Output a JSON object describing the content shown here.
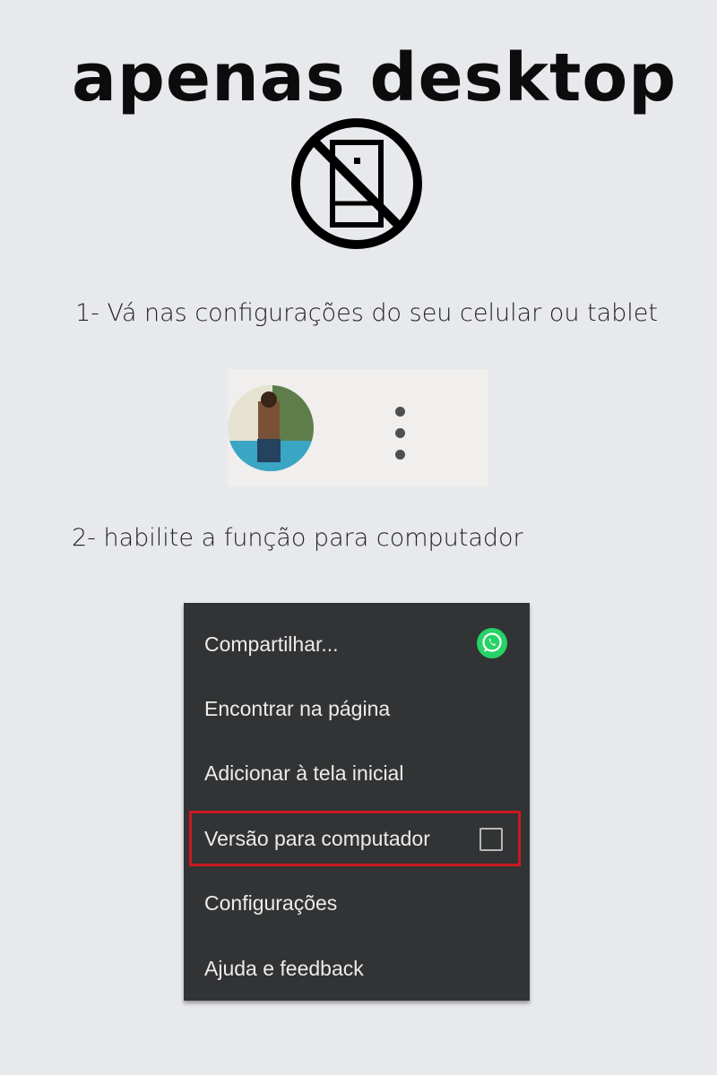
{
  "headline": "apenas desktop",
  "icons": {
    "no_mobile": "no-mobile-phone-icon",
    "whatsapp": "whatsapp-icon",
    "more_options": "more-vert-icon"
  },
  "steps": {
    "step1": "1- Vá nas configurações do seu celular ou tablet",
    "step2": "2- habilite a função para computador"
  },
  "menu": {
    "items": [
      {
        "label": "Compartilhar..."
      },
      {
        "label": "Encontrar na página"
      },
      {
        "label": "Adicionar à tela inicial"
      },
      {
        "label": "Versão para computador",
        "checked": false,
        "highlighted": true
      },
      {
        "label": "Configurações"
      },
      {
        "label": "Ajuda e feedback"
      }
    ]
  },
  "colors": {
    "background": "#e8e9ed",
    "menu_bg": "#323335",
    "highlight": "#c91922",
    "whatsapp": "#25d366"
  }
}
